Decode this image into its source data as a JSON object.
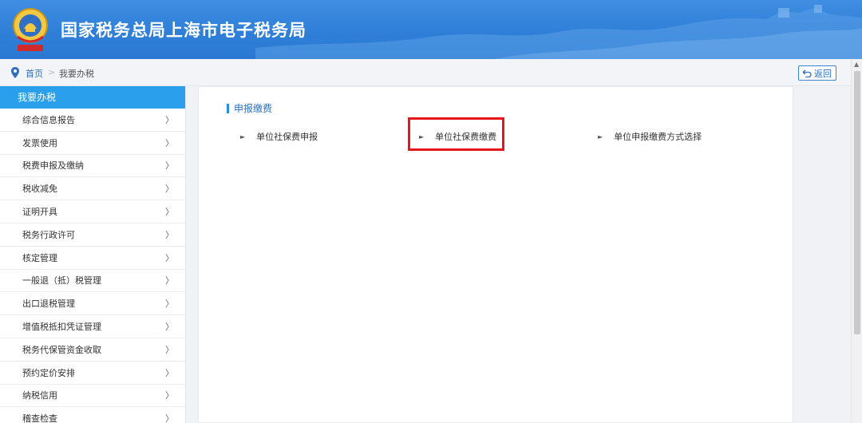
{
  "header": {
    "site_title": "国家税务总局上海市电子税务局",
    "logo_icon": "tax-emblem-icon"
  },
  "breadcrumb": {
    "home": "首页",
    "separator": ">",
    "current": "我要办税",
    "back_label": "返回"
  },
  "sidebar": {
    "heading": "我要办税",
    "chevron": "〉",
    "items": [
      {
        "label": "综合信息报告"
      },
      {
        "label": "发票使用"
      },
      {
        "label": "税费申报及缴纳"
      },
      {
        "label": "税收减免"
      },
      {
        "label": "证明开具"
      },
      {
        "label": "税务行政许可"
      },
      {
        "label": "核定管理"
      },
      {
        "label": "一般退（抵）税管理"
      },
      {
        "label": "出口退税管理"
      },
      {
        "label": "增值税抵扣凭证管理"
      },
      {
        "label": "税务代保管资金收取"
      },
      {
        "label": "预约定价安排"
      },
      {
        "label": "纳税信用"
      },
      {
        "label": "稽查检查"
      }
    ]
  },
  "main": {
    "section_title": "申报缴费",
    "links": [
      {
        "label": "单位社保费申报",
        "arrow": "►"
      },
      {
        "label": "单位社保费缴费",
        "arrow": "►"
      },
      {
        "label": "单位申报缴费方式选择",
        "arrow": "►"
      }
    ]
  },
  "colors": {
    "header_blue": "#2f7fd8",
    "sidebar_active": "#2aa0ec",
    "highlight_red": "#e8141b",
    "link_blue": "#2c6fc1"
  }
}
